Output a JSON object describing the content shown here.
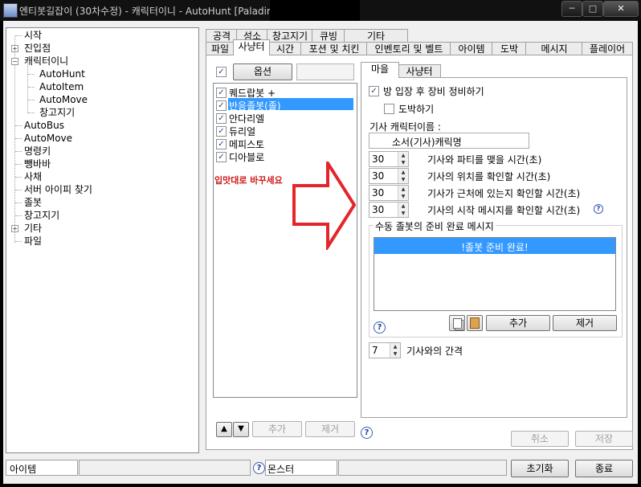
{
  "window": {
    "title": "엔티봇길잡이 (30차수정) - 캐릭터이니 - AutoHunt [Paladin",
    "controls": {
      "minimize": "─",
      "maximize": "□",
      "close": "✕"
    }
  },
  "tree": {
    "items": [
      {
        "label": "시작"
      },
      {
        "label": "진입점"
      },
      {
        "label": "캐릭터이니"
      },
      {
        "label": "AutoHunt"
      },
      {
        "label": "AutoItem"
      },
      {
        "label": "AutoMove"
      },
      {
        "label": "창고지기"
      },
      {
        "label": "AutoBus"
      },
      {
        "label": "AutoMove"
      },
      {
        "label": "명령키"
      },
      {
        "label": "뺑바바"
      },
      {
        "label": "사채"
      },
      {
        "label": "서버 아이피 찾기"
      },
      {
        "label": "졸봇"
      },
      {
        "label": "창고지기"
      },
      {
        "label": "기타"
      },
      {
        "label": "파일"
      }
    ],
    "expand_plus": "+",
    "expand_minus": "−"
  },
  "tabs_row1": [
    "공격",
    "성소",
    "창고지기",
    "큐빙",
    "기타"
  ],
  "tabs_row2": [
    "파일",
    "사냥터",
    "시간",
    "포션 및 치킨",
    "인벤토리 및 벨트",
    "아이템",
    "도박",
    "메시지",
    "플레이어"
  ],
  "left_panel": {
    "options_button": "옵션",
    "characters": [
      "퀘드랍봇 +",
      "반응졸봇(졸)",
      "안다리엘",
      "듀리얼",
      "메피스토",
      "디아블로"
    ],
    "annotation": "입맛대로 바꾸세요",
    "up_arrow": "▲",
    "down_arrow": "▼",
    "add_button": "추가",
    "remove_button": "제거"
  },
  "inner_tabs": [
    "마을",
    "사냥터"
  ],
  "town": {
    "equip_checkbox": "방 입장 후 장비 정비하기",
    "gamble_checkbox": "도박하기",
    "knight_name_label": "기사 캐릭터이름 :",
    "knight_name_value": "소서(기사)캐릭명",
    "spinners": [
      {
        "value": "30",
        "label": "기사와 파티를 맺을 시간(초)"
      },
      {
        "value": "30",
        "label": "기사의 위치를 확인할 시간(초)"
      },
      {
        "value": "30",
        "label": "기사가 근처에 있는지 확인할 시간(초)"
      },
      {
        "value": "30",
        "label": "기사의 시작 메시지를 확인할 시간(초)"
      }
    ],
    "group_title": "수동 졸봇의 준비 완료 메시지",
    "message_item": "!졸봇 준비 완료!",
    "add_button": "추가",
    "remove_button": "제거",
    "interval_value": "7",
    "interval_label": "기사와의 간격",
    "help_glyph": "?"
  },
  "footer": {
    "cancel_button": "취소",
    "save_button": "저장",
    "item_label": "아이템",
    "monster_label": "몬스터",
    "reset_button": "초기화",
    "exit_button": "종료"
  },
  "colors": {
    "selection": "#3399ff",
    "annotation_red": "#d11a1a",
    "arrow_red": "#e3262c"
  }
}
